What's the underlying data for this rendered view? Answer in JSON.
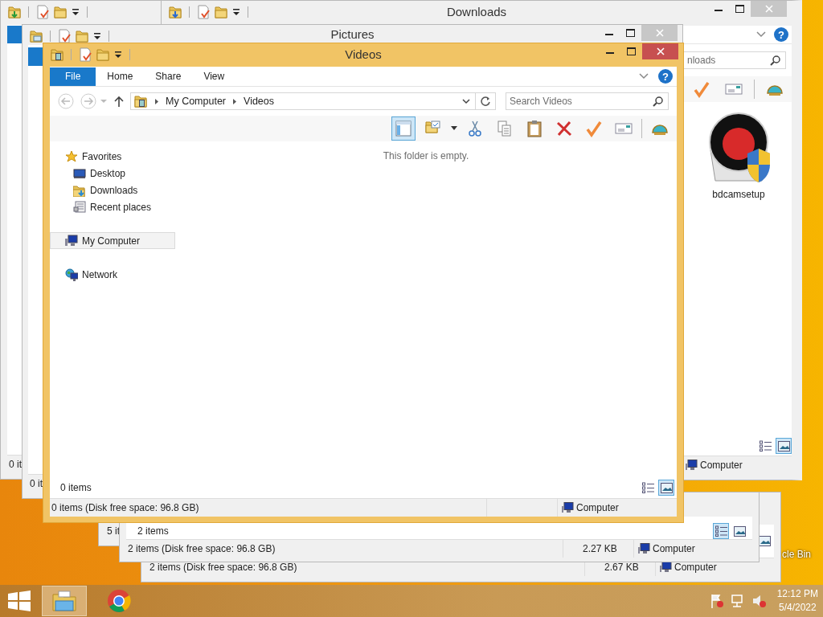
{
  "desktop": {
    "recycle_bin_label": "cle Bin"
  },
  "window_lower_back": {
    "view_buttons": [
      {
        "kind": "large-icons",
        "selected": false
      }
    ],
    "status_text": "2 items (Disk free space: 96.8 GB)",
    "status_size": "2.67 KB",
    "status_location": "Computer"
  },
  "window_lower_left": {
    "status_text": "5 it"
  },
  "window_lower_front": {
    "item_count": "2 items",
    "view_buttons": [
      {
        "kind": "details",
        "selected": true
      },
      {
        "kind": "large-icons",
        "selected": false
      }
    ],
    "status_text": "2 items (Disk free space: 96.8 GB)",
    "status_size": "2.27 KB",
    "status_location": "Computer"
  },
  "window_left": {
    "status_text": "0 it"
  },
  "window_downloads": {
    "title": "Downloads",
    "help": "?",
    "search": {
      "placeholder": "nloads"
    },
    "files": [
      {
        "name": "bdcamsetup"
      }
    ],
    "view_buttons": [
      {
        "kind": "details",
        "selected": false
      },
      {
        "kind": "large-icons",
        "selected": true
      }
    ],
    "status_location": "Computer"
  },
  "window_pictures": {
    "title": "Pictures",
    "status_text": "0 it"
  },
  "window_videos": {
    "title": "Videos",
    "help": "?",
    "tabs": [
      {
        "kind": "file-menu",
        "label": "File"
      },
      {
        "kind": "tab",
        "label": "Home"
      },
      {
        "kind": "tab",
        "label": "Share"
      },
      {
        "kind": "tab",
        "label": "View"
      }
    ],
    "breadcrumbs": [
      "My Computer",
      "Videos"
    ],
    "search": {
      "placeholder": "Search Videos"
    },
    "toolbar": [
      {
        "kind": "preview-pane",
        "on": true
      },
      {
        "kind": "folder-check",
        "on": false
      },
      {
        "kind": "cut",
        "on": false
      },
      {
        "kind": "copy",
        "on": false
      },
      {
        "kind": "paste",
        "on": false
      },
      {
        "kind": "delete",
        "on": false
      },
      {
        "kind": "check",
        "on": false
      },
      {
        "kind": "card",
        "on": false
      },
      {
        "kind": "shell",
        "on": false
      }
    ],
    "nav": [
      {
        "label": "Favorites",
        "selected": false,
        "children": [
          {
            "label": "Desktop",
            "selected": false
          },
          {
            "label": "Downloads",
            "selected": false
          },
          {
            "label": "Recent places",
            "selected": false
          }
        ]
      },
      {
        "label": "My Computer",
        "selected": true
      },
      {
        "label": "Network",
        "selected": false
      }
    ],
    "empty_message": "This folder is empty.",
    "item_count": "0 items",
    "view_buttons": [
      {
        "kind": "details",
        "selected": false
      },
      {
        "kind": "large-icons",
        "selected": true
      }
    ],
    "status_text": "0 items (Disk free space: 96.8 GB)",
    "status_location": "Computer"
  },
  "taskbar": {
    "buttons": [
      {
        "kind": "explorer",
        "active": true
      },
      {
        "kind": "chrome",
        "active": false
      }
    ],
    "time": "12:12 PM",
    "date": "5/4/2022"
  }
}
